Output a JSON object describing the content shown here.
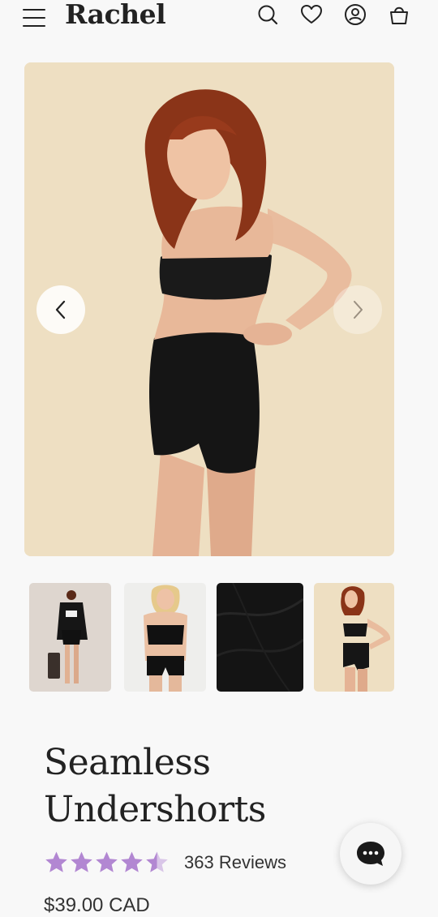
{
  "header": {
    "logo": "Rachel",
    "icons": [
      "menu-icon",
      "search-icon",
      "heart-icon",
      "account-icon",
      "bag-icon"
    ]
  },
  "gallery": {
    "main_image_alt": "",
    "thumbnail_count": 4,
    "background_color": "#eedfc2"
  },
  "product": {
    "title": "Seamless Undershorts",
    "rating": 4.5,
    "rating_max": 5,
    "reviews_label": "363 Reviews",
    "price": "$39.00 CAD"
  },
  "colors": {
    "star": "#b287d2",
    "text": "#222222",
    "page_bg": "#f8f8f8",
    "chat_dot_bg": "#1a1a1a"
  }
}
